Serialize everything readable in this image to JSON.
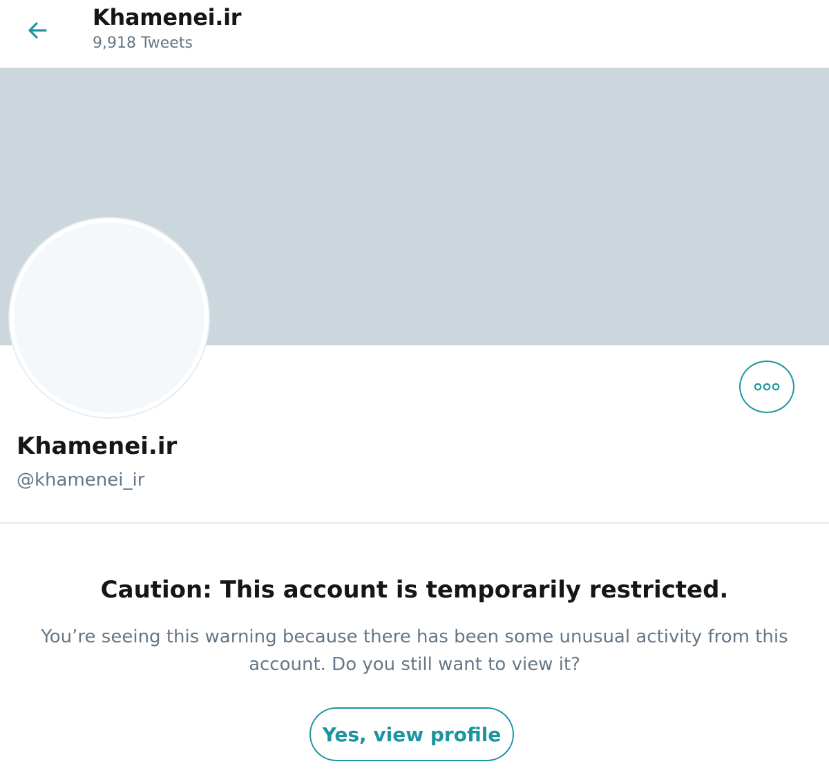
{
  "colors": {
    "accent": "#1b95a0",
    "banner": "#ccd6dd",
    "avatar_fill": "#f5f8fa",
    "text_primary": "#14171a",
    "text_secondary": "#657786"
  },
  "header": {
    "back_icon": "arrow-left-icon",
    "title": "Khamenei.ir",
    "tweet_count": "9,918 Tweets"
  },
  "profile": {
    "more_icon": "more-options-icon",
    "name": "Khamenei.ir",
    "handle": "@khamenei_ir"
  },
  "warning": {
    "title": "Caution: This account is temporarily restricted.",
    "message": "You’re seeing this warning because there has been some unusual activity from this account. Do you still want to view it?",
    "button_label": "Yes, view profile"
  }
}
